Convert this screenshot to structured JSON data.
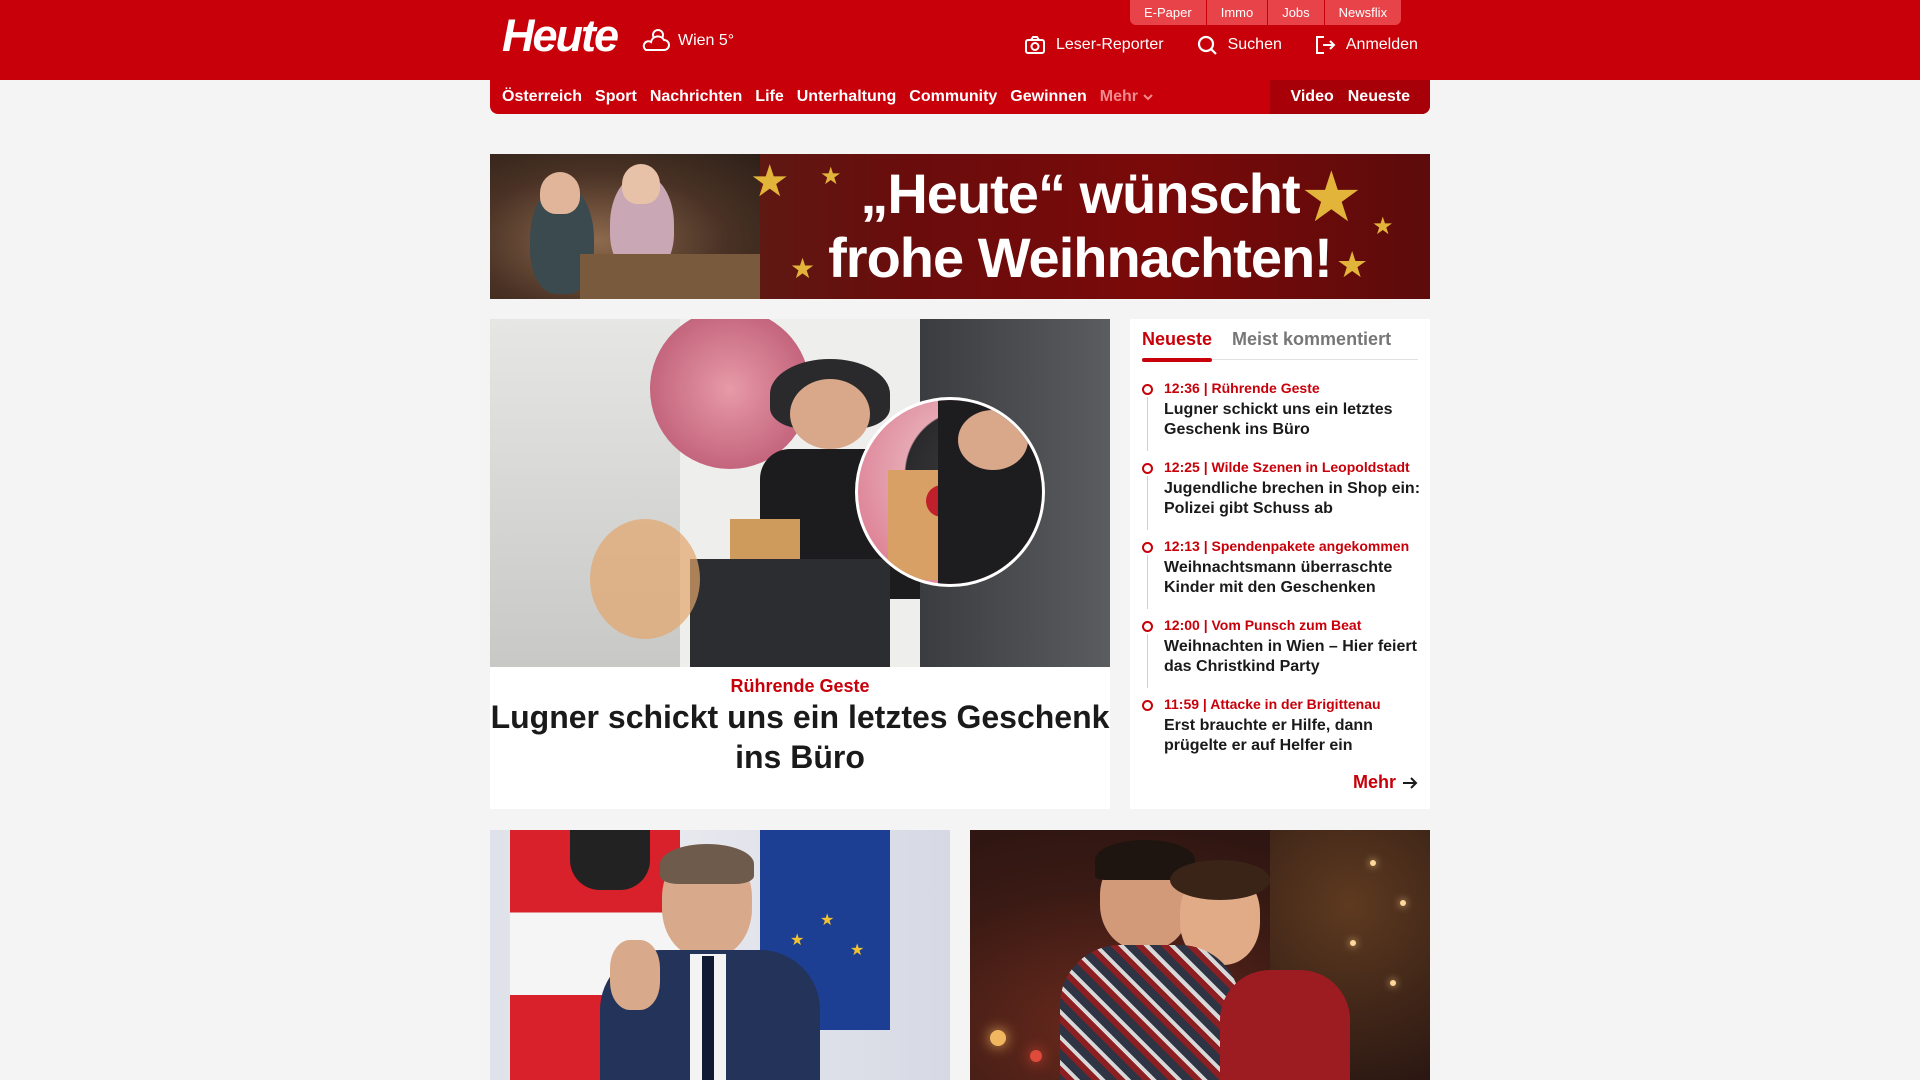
{
  "brand": {
    "logo": "Heute",
    "weather": "Wien 5°"
  },
  "top_links": [
    "E-Paper",
    "Immo",
    "Jobs",
    "Newsflix"
  ],
  "header_actions": [
    {
      "label": "Leser-Reporter",
      "icon": "camera-icon"
    },
    {
      "label": "Suchen",
      "icon": "search-icon"
    },
    {
      "label": "Anmelden",
      "icon": "login-icon"
    }
  ],
  "nav": {
    "items": [
      "Österreich",
      "Sport",
      "Nachrichten",
      "Life",
      "Unterhaltung",
      "Community",
      "Gewinnen"
    ],
    "more": "Mehr",
    "right": [
      "Video",
      "Neueste"
    ]
  },
  "banner": {
    "line1": "„Heute“ wünscht",
    "line2": "frohe Weihnachten!"
  },
  "main_teaser": {
    "kicker": "Rührende Geste",
    "headline": "Lugner schickt uns ein letztes Geschenk ins Büro"
  },
  "sidebar": {
    "tabs": [
      "Neueste",
      "Meist kommentiert"
    ],
    "items": [
      {
        "meta": "12:36 | Rührende Geste",
        "title": "Lugner schickt uns ein letztes Geschenk ins Büro"
      },
      {
        "meta": "12:25 | Wilde Szenen in Leopoldstadt",
        "title": "Jugendliche brechen in Shop ein: Polizei gibt Schuss ab"
      },
      {
        "meta": "12:13 | Spendenpakete angekommen",
        "title": "Weihnachtsmann überraschte Kinder mit den Geschenken"
      },
      {
        "meta": "12:00 | Vom Punsch zum Beat",
        "title": "Weihnachten in Wien – Hier feiert das Christkind Party"
      },
      {
        "meta": "11:59 | Attacke in der Brigittenau",
        "title": "Erst brauchte er Hilfe, dann prügelte er auf Helfer ein"
      }
    ],
    "more": "Mehr"
  },
  "colors": {
    "brand_red": "#c8000a",
    "dark_red": "#a80008",
    "background": "#f4f4f4"
  }
}
